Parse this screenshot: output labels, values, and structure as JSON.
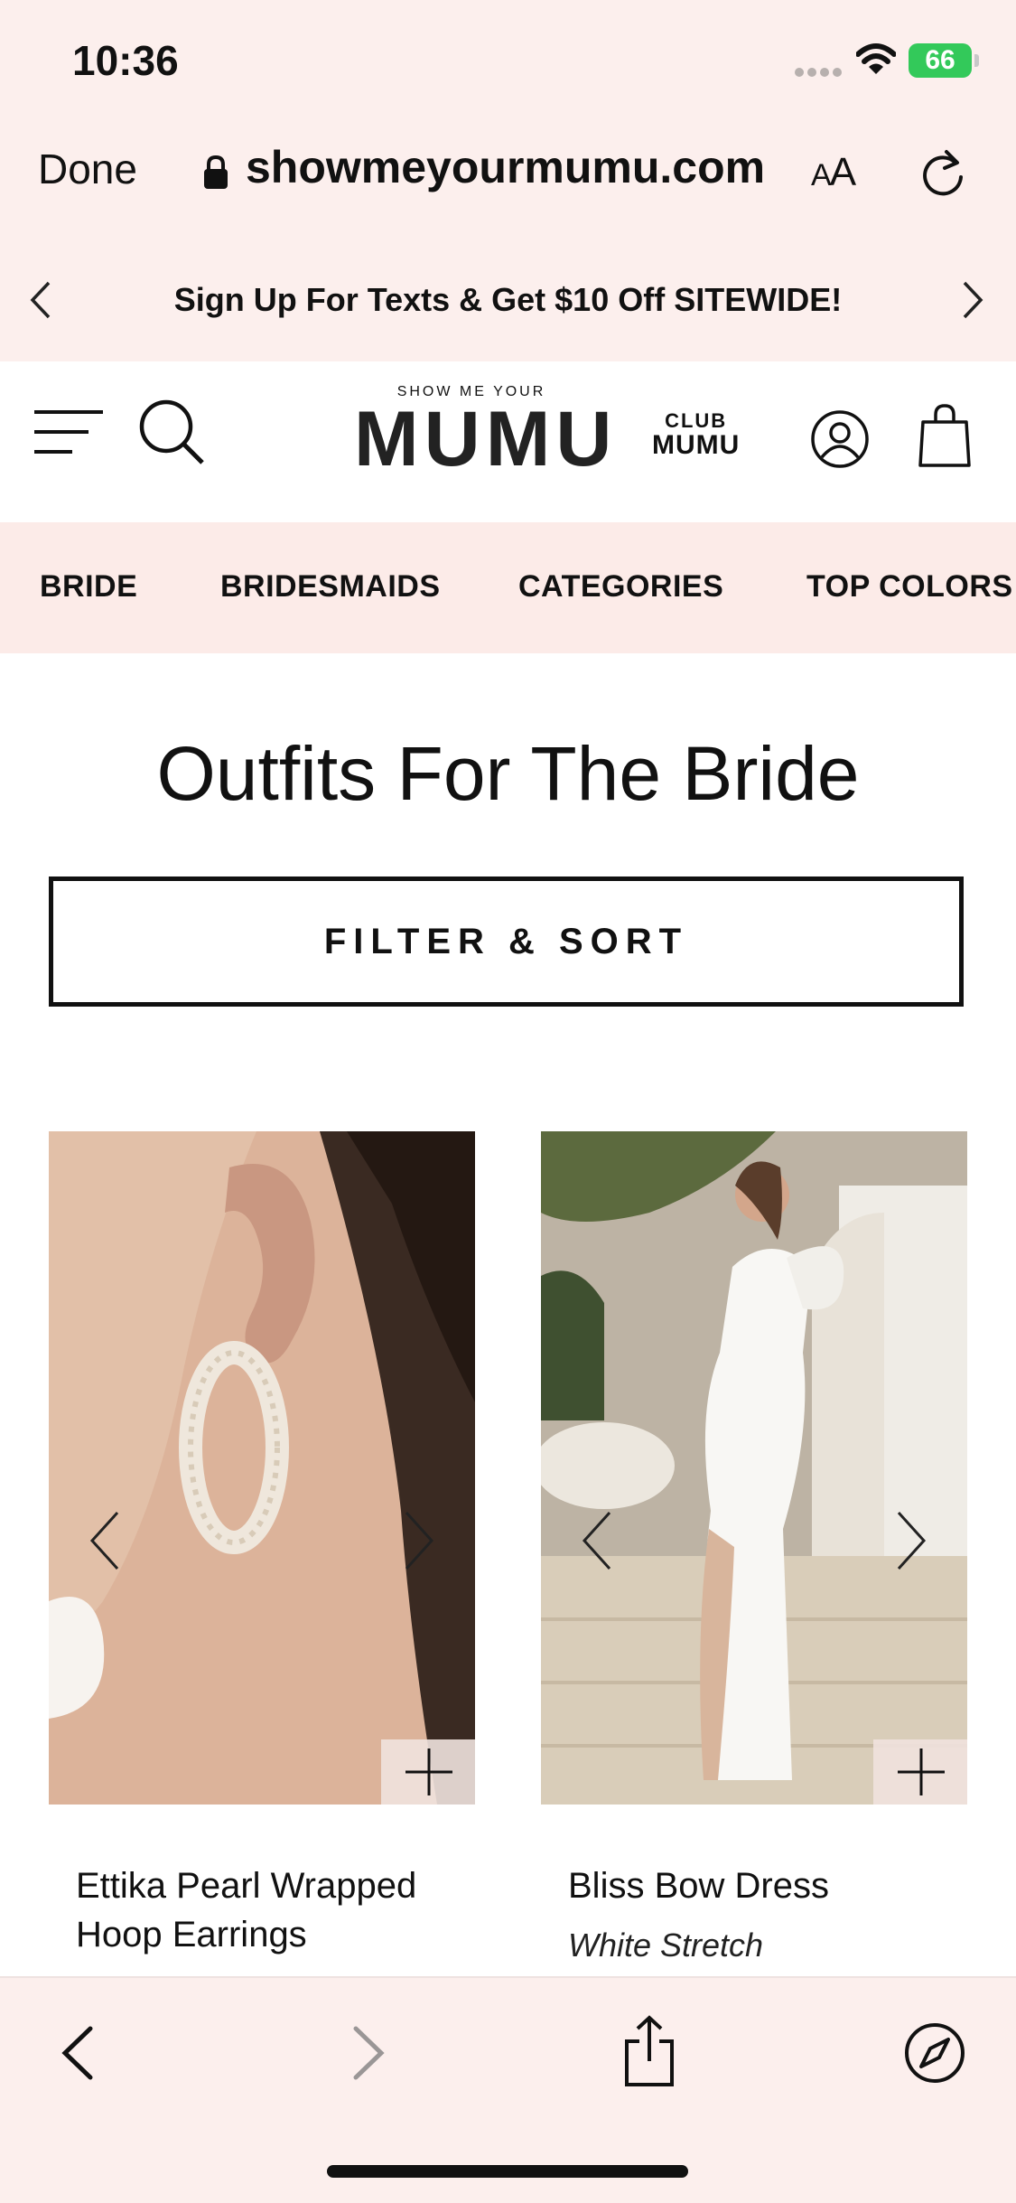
{
  "status_bar": {
    "time": "10:36",
    "battery": "66"
  },
  "url_bar": {
    "done_label": "Done",
    "url": "showmeyourmumu.com",
    "aa_label": "AA"
  },
  "promo": {
    "text": "Sign Up For Texts & Get $10 Off SITEWIDE!"
  },
  "header": {
    "logo_top": "SHOW ME YOUR",
    "logo_main": "MUMU",
    "club_top": "CLUB",
    "club_bottom": "MUMU"
  },
  "nav": {
    "items": [
      "BRIDE",
      "BRIDESMAIDS",
      "CATEGORIES",
      "TOP COLORS"
    ]
  },
  "page": {
    "title": "Outfits For The Bride",
    "filter_label": "FILTER & SORT"
  },
  "products": [
    {
      "name": "Ettika Pearl Wrapped Hoop Earrings",
      "color": ""
    },
    {
      "name": "Bliss Bow Dress",
      "color": "White Stretch"
    }
  ],
  "colors": {
    "chrome_bg": "#fcefed",
    "nav_bg": "#fcebe8",
    "battery": "#33c95a"
  }
}
